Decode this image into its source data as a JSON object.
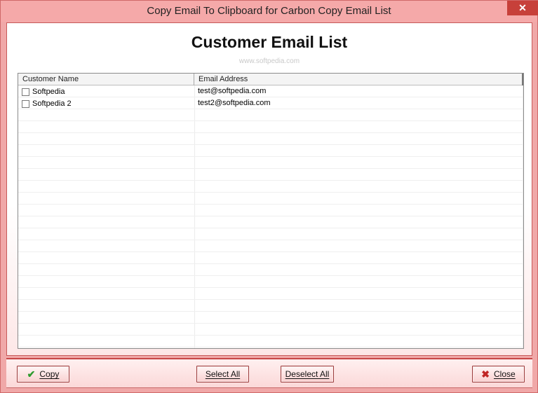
{
  "window": {
    "title": "Copy Email To Clipboard for Carbon Copy Email List",
    "close_glyph": "✕"
  },
  "main": {
    "heading": "Customer Email List",
    "watermark": "www.softpedia.com"
  },
  "table": {
    "columns": [
      "Customer Name",
      "Email Address"
    ],
    "rows": [
      {
        "name": "Softpedia",
        "email": "test@softpedia.com",
        "checked": false
      },
      {
        "name": "Softpedia 2",
        "email": "test2@softpedia.com",
        "checked": false
      }
    ]
  },
  "buttons": {
    "copy": "Copy",
    "select_all": "Select All",
    "deselect_all": "Deselect All",
    "close": "Close"
  },
  "icons": {
    "copy": "check-icon",
    "close": "x-icon"
  },
  "colors": {
    "frame": "#f0a8a8",
    "close_button": "#c7403a",
    "check": "#2e9a2e",
    "cross": "#c02424"
  }
}
